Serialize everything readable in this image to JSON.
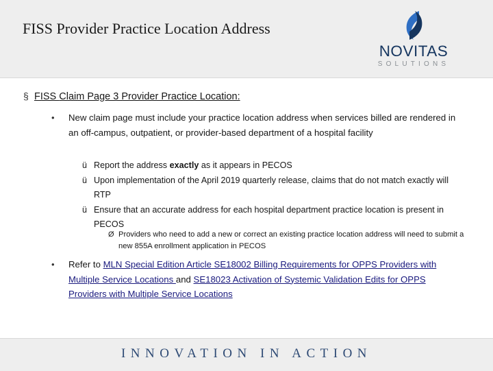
{
  "header": {
    "title": "FISS Provider Practice Location Address",
    "logo": {
      "wordmark": "NOVITAS",
      "subtitle": "SOLUTIONS",
      "mark_color": "#1f4e9c",
      "word_color": "#15355f"
    }
  },
  "content": {
    "level1": {
      "bullet": "§",
      "underlined_text": "FISS ",
      "rest_text": "Claim Page 3 Provider Practice Location:"
    },
    "bullet1": {
      "marker": "•",
      "text": "New claim page must include your practice location address when services billed are rendered in an off-campus, outpatient, or provider-based department of a hospital facility"
    },
    "checks": [
      {
        "marker": "ü",
        "pre": "Report the address ",
        "bold": "exactly",
        "post": " as it appears in PECOS"
      },
      {
        "marker": "ü",
        "pre": "Upon implementation of the April 2019 quarterly release, claims that do not match exactly will RTP",
        "bold": "",
        "post": ""
      },
      {
        "marker": "ü",
        "pre": "Ensure that an accurate address for each hospital department practice location is present in PECOS",
        "bold": "",
        "post": ""
      }
    ],
    "level4": {
      "marker": "Ø",
      "text": "Providers who need to add a new or correct an existing practice location address will need to submit a new 855A enrollment application in PECOS"
    },
    "bullet2": {
      "marker": "•",
      "prefix": "Refer to ",
      "link1": "MLN Special Edition Article SE18002 Billing Requirements for OPPS Providers with Multiple Service Locations ",
      "middle": "and ",
      "link2": "SE18023 Activation of Systemic Validation Edits for OPPS Providers with Multiple Service Locations",
      "link_color": "#1a1a7e"
    }
  },
  "footer": {
    "text": "INNOVATION IN ACTION"
  }
}
